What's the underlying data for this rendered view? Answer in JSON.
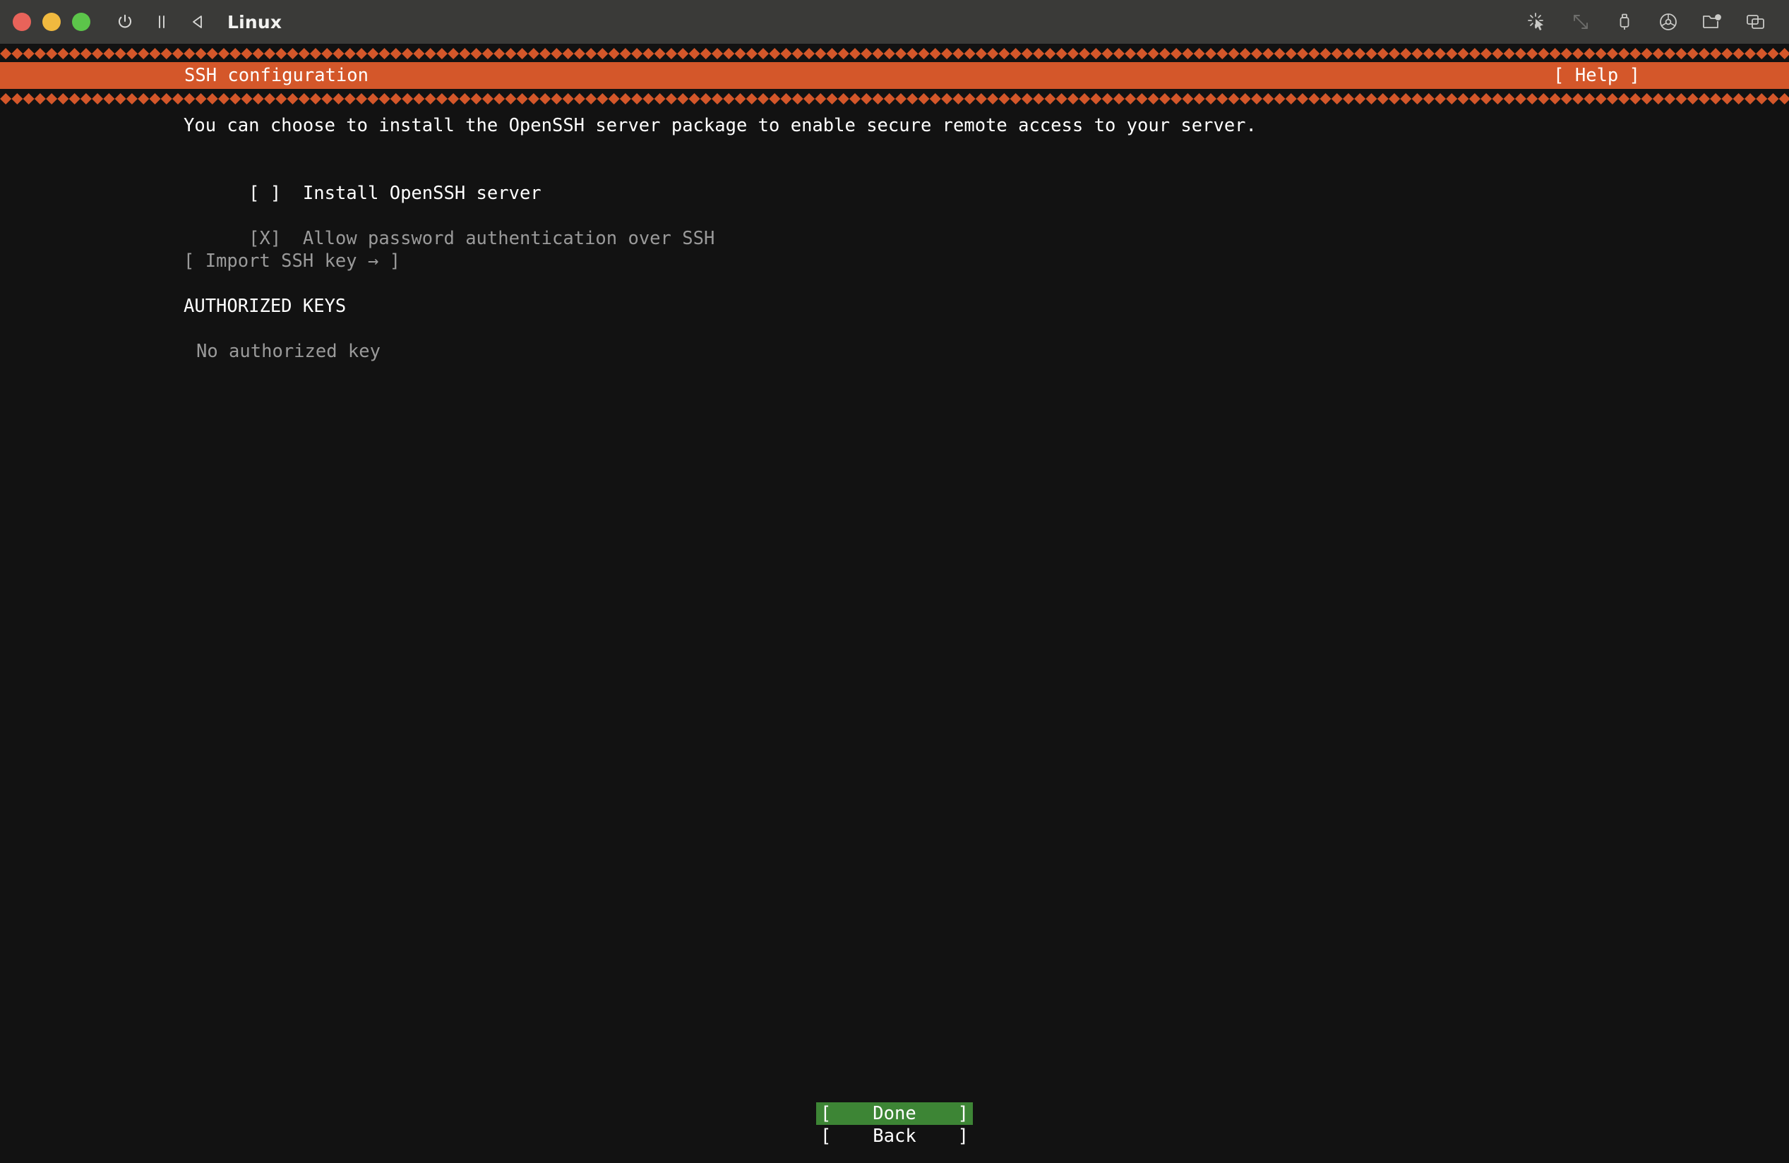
{
  "window": {
    "vm_title": "Linux",
    "controls": {
      "close_label": "close",
      "minimize_label": "minimize",
      "maximize_label": "maximize",
      "power_label": "power",
      "pause_label": "pause",
      "back_label": "back"
    },
    "toolbar_icons": [
      {
        "name": "pointer-capture-icon",
        "label": "Pointer capture",
        "dim": false
      },
      {
        "name": "resize-icon",
        "label": "Resize window",
        "dim": true
      },
      {
        "name": "usb-icon",
        "label": "USB devices",
        "dim": false
      },
      {
        "name": "optical-disc-icon",
        "label": "Optical drive",
        "dim": false
      },
      {
        "name": "shared-folder-icon",
        "label": "Shared folders",
        "dim": false
      },
      {
        "name": "screens-icon",
        "label": "Screens",
        "dim": false
      }
    ]
  },
  "colors": {
    "titlebar_bg": "#3a3a38",
    "terminal_bg": "#121212",
    "accent_orange": "#d4572a",
    "selected_green": "#3d8535",
    "bright_text": "#ffffff",
    "dim_text": "#9a9a9a",
    "dot_red": "#e8635a",
    "dot_yellow": "#f0b93f",
    "dot_green": "#5cc54a"
  },
  "installer": {
    "header": {
      "title": "SSH configuration",
      "help": "[ Help ]",
      "pattern_glyph": "◆"
    },
    "description": "You can choose to install the OpenSSH server package to enable secure remote access to your server.",
    "options": [
      {
        "checkbox": "[ ]",
        "label": "Install OpenSSH server",
        "checked": false,
        "state": "active"
      },
      {
        "checkbox": "[X]",
        "label": "Allow password authentication over SSH",
        "checked": true,
        "state": "disabled"
      }
    ],
    "import_key_button": "[ Import SSH key → ]",
    "authorized_keys": {
      "heading": "AUTHORIZED KEYS",
      "empty_text": "No authorized key"
    },
    "footer_buttons": [
      {
        "open": "[",
        "label": "Done",
        "close": "]",
        "selected": true
      },
      {
        "open": "[",
        "label": "Back",
        "close": "]",
        "selected": false
      }
    ]
  }
}
